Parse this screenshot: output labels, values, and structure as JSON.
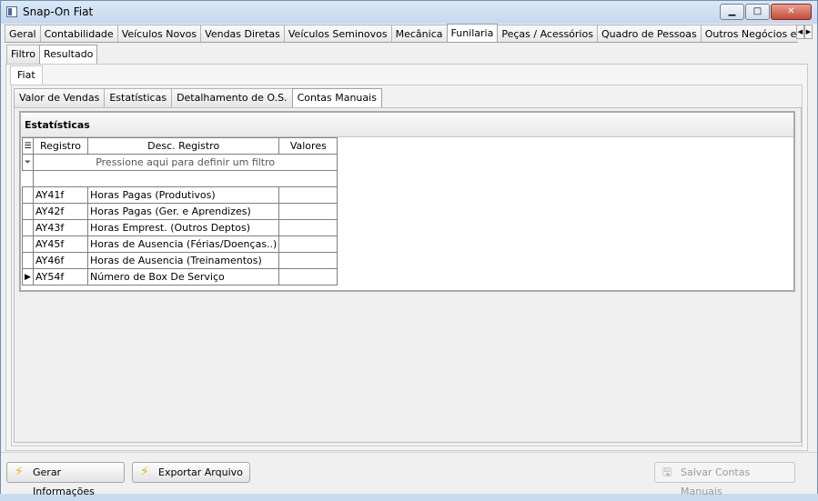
{
  "window": {
    "title": "Snap-On Fiat"
  },
  "main_tabs": [
    "Geral",
    "Contabilidade",
    "Veículos Novos",
    "Vendas Diretas",
    "Veículos Seminovos",
    "Mecânica",
    "Funilaria",
    "Peças / Acessórios",
    "Quadro de Pessoas",
    "Outros Negócios e Outras Mar"
  ],
  "sub_tabs": [
    "Filtro",
    "Resultado"
  ],
  "brand_tab": "Fiat",
  "inner_tabs": [
    "Valor de Vendas",
    "Estatísticas",
    "Detalhamento de O.S.",
    "Contas Manuais"
  ],
  "grid": {
    "title": "Estatísticas",
    "columns": [
      "Registro",
      "Desc. Registro",
      "Valores"
    ],
    "filter_hint": "Pressione aqui para definir um filtro",
    "rows": [
      {
        "reg": "AY41f",
        "desc": "Horas Pagas (Produtivos)",
        "val": ""
      },
      {
        "reg": "AY42f",
        "desc": "Horas Pagas (Ger. e Aprendizes)",
        "val": ""
      },
      {
        "reg": "AY43f",
        "desc": "Horas Emprest. (Outros Deptos)",
        "val": ""
      },
      {
        "reg": "AY45f",
        "desc": "Horas de Ausencia (Férias/Doenças..)",
        "val": ""
      },
      {
        "reg": "AY46f",
        "desc": "Horas de Ausencia (Treinamentos)",
        "val": ""
      },
      {
        "reg": "AY54f",
        "desc": "Número de Box De Serviço",
        "val": ""
      }
    ]
  },
  "buttons": {
    "gerar": "Gerar Informações",
    "exportar": "Exportar Arquivo",
    "salvar": "Salvar Contas Manuais"
  }
}
